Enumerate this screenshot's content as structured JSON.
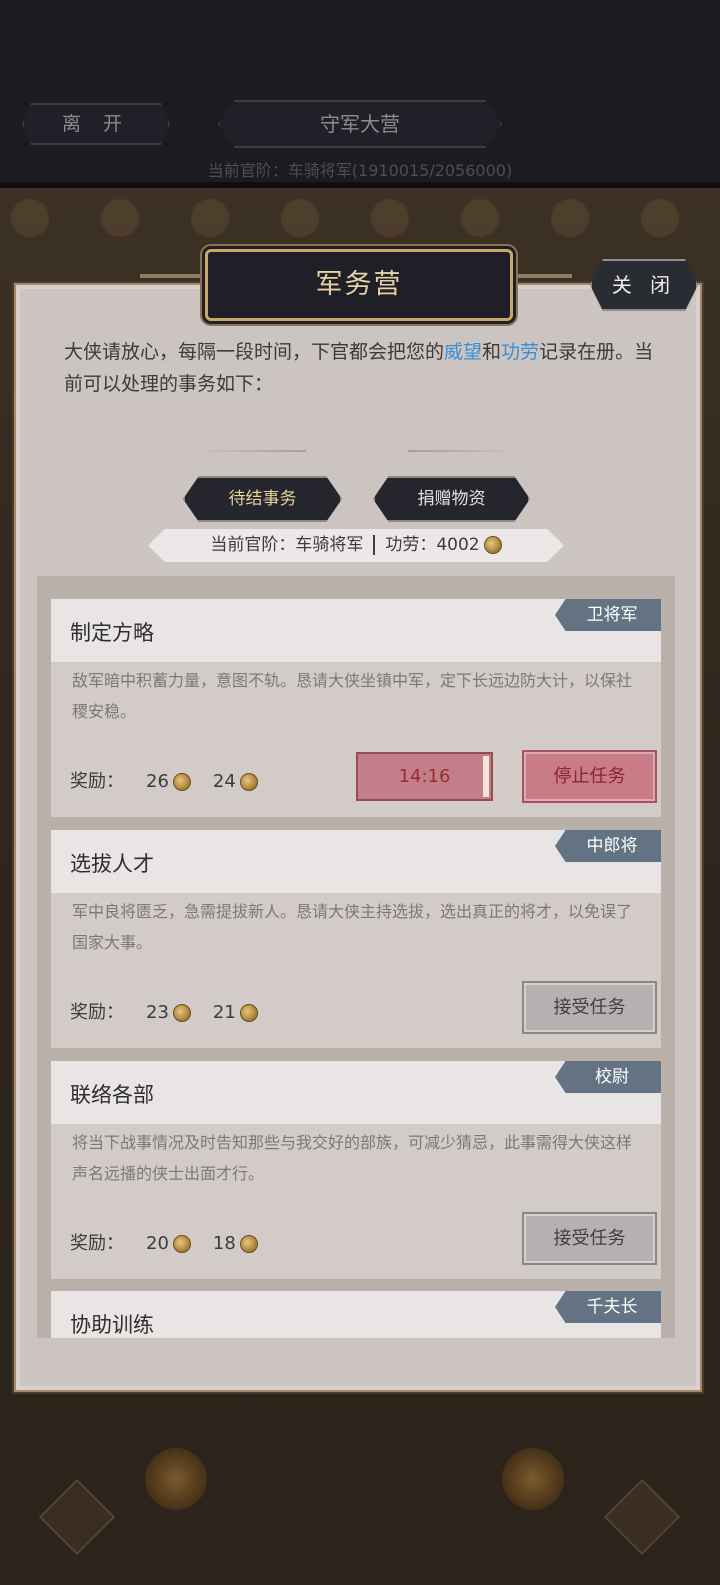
{
  "topbar": {
    "leave_label": "离 开",
    "camp_label": "守军大营",
    "rank_line": "当前官阶：车骑将军(1910015/2056000)"
  },
  "panel": {
    "title": "军务营",
    "close_label": "关 闭",
    "intro_part1": "大侠请放心，每隔一段时间，下官都会把您的",
    "intro_highlight1": "威望",
    "intro_and": "和",
    "intro_highlight2": "功劳",
    "intro_part2": "记录在册。当前可以处理的事务如下：",
    "tabs": [
      {
        "label": "待结事务"
      },
      {
        "label": "捐赠物资"
      }
    ],
    "rank_label": "当前官阶：车骑将军",
    "merit_label": "功劳：4002"
  },
  "tasks": [
    {
      "title": "制定方略",
      "rank": "卫将军",
      "desc": "敌军暗中积蓄力量，意图不轨。恳请大侠坐镇中军，定下长远边防大计，以保社稷安稳。",
      "reward_label": "奖励：",
      "reward1": "26",
      "reward2": "24",
      "timer": "14:16",
      "action": "停止任务"
    },
    {
      "title": "选拔人才",
      "rank": "中郎将",
      "desc": "军中良将匮乏，急需提拔新人。恳请大侠主持选拔，选出真正的将才，以免误了国家大事。",
      "reward_label": "奖励：",
      "reward1": "23",
      "reward2": "21",
      "action": "接受任务"
    },
    {
      "title": "联络各部",
      "rank": "校尉",
      "desc": "将当下战事情况及时告知那些与我交好的部族，可减少猜忌，此事需得大侠这样声名远播的侠士出面才行。",
      "reward_label": "奖励：",
      "reward1": "20",
      "reward2": "18",
      "action": "接受任务"
    },
    {
      "title": "协助训练",
      "rank": "千夫长"
    }
  ],
  "colors": {
    "accent_blue": "#3a8fd6",
    "badge": "#647383",
    "stop": "#c97c88"
  }
}
